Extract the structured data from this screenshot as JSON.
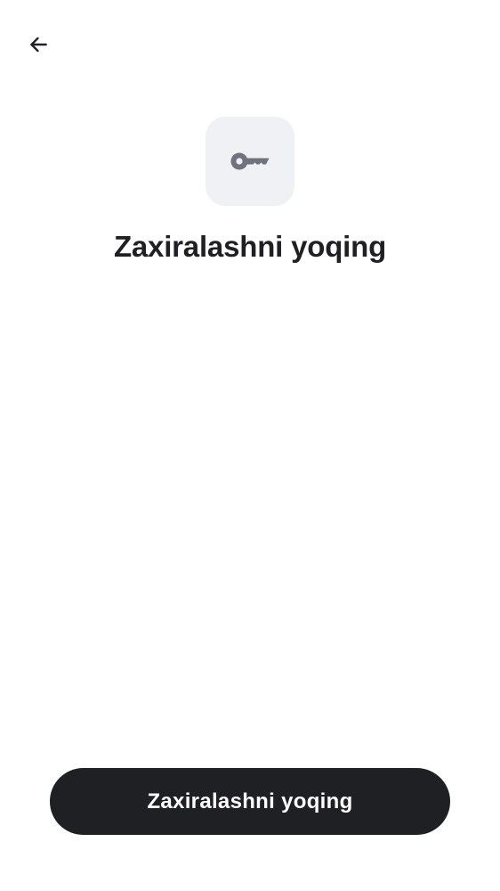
{
  "header": {
    "back_icon": "arrow-left-icon"
  },
  "hero": {
    "icon": "key-icon",
    "title": "Zaxiralashni yoqing"
  },
  "footer": {
    "primary_button_label": "Zaxiralashni yoqing"
  },
  "colors": {
    "text": "#1f2024",
    "button_background": "#1f2024",
    "button_text": "#ffffff",
    "icon_tile_background": "#f0f1f5",
    "icon_color": "#6f7380",
    "page_background": "#ffffff"
  }
}
